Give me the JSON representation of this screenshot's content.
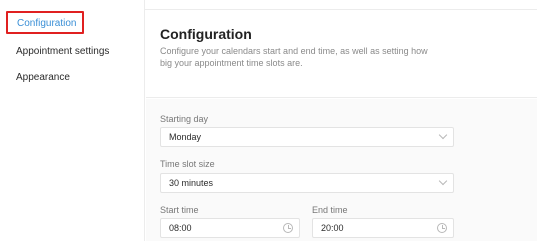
{
  "sidebar": {
    "items": [
      {
        "label": "Configuration",
        "active": true
      },
      {
        "label": "Appointment settings",
        "active": false
      },
      {
        "label": "Appearance",
        "active": false
      }
    ]
  },
  "main": {
    "title": "Configuration",
    "description": "Configure your calendars start and end time, as well as setting how big your appointment time slots are."
  },
  "form": {
    "starting_day": {
      "label": "Starting day",
      "value": "Monday"
    },
    "time_slot_size": {
      "label": "Time slot size",
      "value": "30 minutes"
    },
    "start_time": {
      "label": "Start time",
      "value": "08:00"
    },
    "end_time": {
      "label": "End time",
      "value": "20:00"
    }
  },
  "colors": {
    "active_link": "#3a8fd6",
    "highlight_border": "#e02020"
  }
}
